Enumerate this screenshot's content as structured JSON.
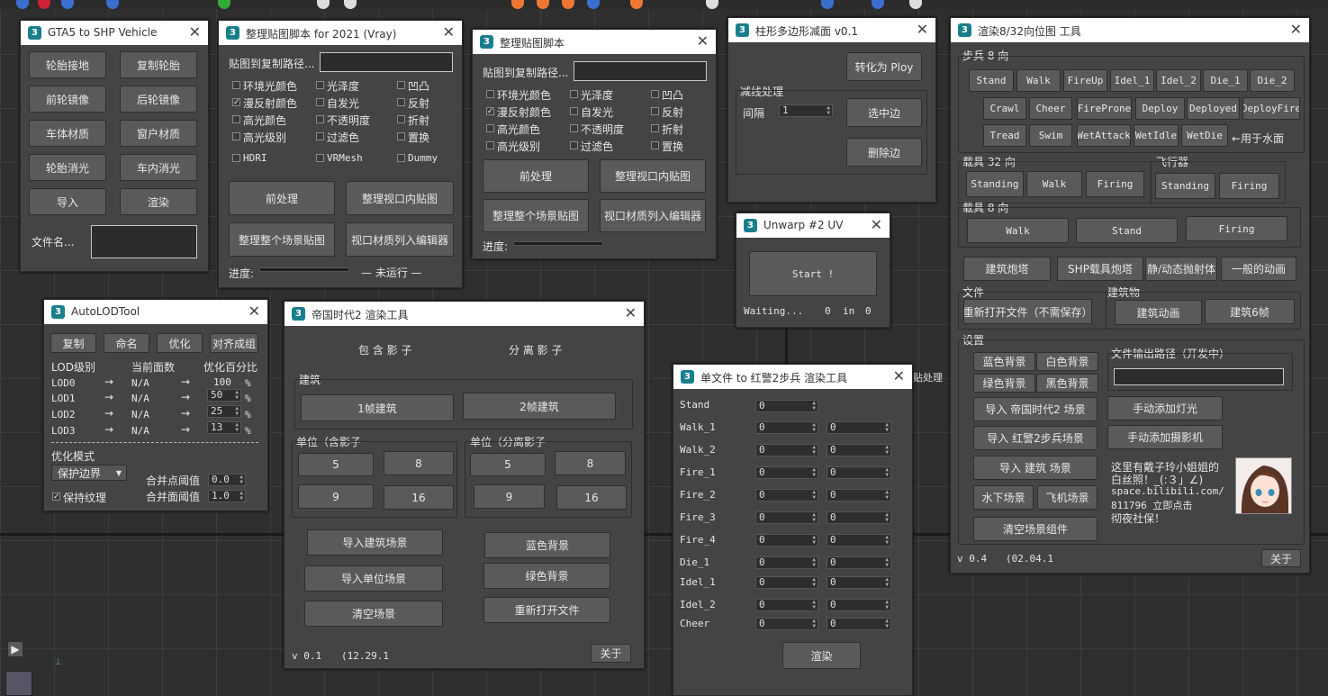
{
  "colors": {
    "accent": "#1a7f8c",
    "viewport": "#2f2f2f",
    "panel": "#444444",
    "button": "#5a5a5a"
  },
  "gta": {
    "title": "GTA5 to SHP Vehicle",
    "btns": [
      "轮胎接地",
      "复制轮胎",
      "前轮镜像",
      "后轮镜像",
      "车体材质",
      "窗户材质",
      "轮胎消光",
      "车内消光",
      "导入",
      "渲染"
    ],
    "file_label": "文件名..."
  },
  "tex21": {
    "title": "整理贴图脚本 for 2021 (Vray)",
    "path_label": "贴图到复制路径...",
    "cbs": [
      "环境光颜色",
      "光泽度",
      "凹凸",
      "漫反射颜色",
      "自发光",
      "反射",
      "高光颜色",
      "不透明度",
      "折射",
      "高光级别",
      "过滤色",
      "置换",
      "HDRI",
      "VRMesh",
      "Dummy"
    ],
    "btns": [
      "前处理",
      "整理视口内贴图",
      "整理整个场景贴图",
      "视口材质列入编辑器"
    ],
    "progress_label": "进度:",
    "status": "— 未运行 —"
  },
  "tex": {
    "title": "整理贴图脚本",
    "path_label": "贴图到复制路径...",
    "cbs": [
      "环境光颜色",
      "光泽度",
      "凹凸",
      "漫反射颜色",
      "自发光",
      "反射",
      "高光颜色",
      "不透明度",
      "折射",
      "高光级别",
      "过滤色",
      "置换"
    ],
    "btns": [
      "前处理",
      "整理视口内贴图",
      "整理整个场景贴图",
      "视口材质列入编辑器"
    ],
    "progress_label": "进度:"
  },
  "poly": {
    "title": "柱形多边形减面 v0.1",
    "convert": "转化为 Ploy",
    "group": "减线处理",
    "interval": "间隔",
    "interval_val": "1",
    "select_edge": "选中边",
    "delete_edge": "删除边"
  },
  "unwrap": {
    "title": "Unwarp #2 UV",
    "start": "Start !",
    "waiting": "Waiting...",
    "count": "0",
    "in": "in",
    "total": "0"
  },
  "lod": {
    "title": "AutoLODTool",
    "btns": [
      "复制",
      "命名",
      "优化",
      "对齐成组"
    ],
    "h1": "LOD级别",
    "h2": "当前面数",
    "h3": "优化百分比",
    "rows": [
      {
        "n": "LOD0",
        "c": "N/A",
        "v": "100"
      },
      {
        "n": "LOD1",
        "c": "N/A",
        "v": "50"
      },
      {
        "n": "LOD2",
        "c": "N/A",
        "v": "25"
      },
      {
        "n": "LOD3",
        "c": "N/A",
        "v": "13"
      }
    ],
    "arrow": "→",
    "pct": "%",
    "mode_label": "优化模式",
    "mode": "保护边界",
    "merge_pt": "合并点阈值",
    "merge_pt_v": "0.0",
    "merge_face": "合并面阈值",
    "merge_face_v": "1.0",
    "keep": "保持纹理"
  },
  "aoe": {
    "title": "帝国时代2 渲染工具",
    "h_shadow": "包 含 影 子",
    "h_sep": "分 离 影 子",
    "bld": "建筑",
    "b1": "1帧建筑",
    "b2": "2帧建筑",
    "unit1": "单位（含影子",
    "unit2": "单位（分离影子",
    "n": [
      "5",
      "8",
      "9",
      "16"
    ],
    "imp_b": "导入建筑场景",
    "imp_u": "导入单位场景",
    "clear": "清空场景",
    "blue": "蓝色背景",
    "green": "绿色背景",
    "reopen": "重新打开文件",
    "ver": "v 0.1",
    "date": "(12.29.1",
    "about": "关于"
  },
  "ra2": {
    "title": "单文件 to 红警2步兵 渲染工具",
    "rows": [
      "Stand",
      "Walk_1",
      "Walk_2",
      "Fire_1",
      "Fire_2",
      "Fire_3",
      "Fire_4",
      "Die_1",
      "Idel_1",
      "Idel_2",
      "Cheer"
    ],
    "v": "0",
    "render": "渲染",
    "bg_text": "贴处理 ]"
  },
  "r8": {
    "title": "渲染8/32向位图 工具",
    "inf": "步兵 8 向",
    "inf1": [
      "Stand",
      "Walk",
      "FireUp",
      "Idel_1",
      "Idel_2",
      "Die_1",
      "Die_2"
    ],
    "inf2": [
      "Crawl",
      "Cheer",
      "FireProne",
      "Deploy",
      "Deployed",
      "DeployFire"
    ],
    "inf3": [
      "Tread",
      "Swim",
      "WetAttack",
      "WetIdle",
      "WetDie"
    ],
    "water": "←用于水面",
    "veh32": "载具 32 向",
    "veh32b": [
      "Standing",
      "Walk",
      "Firing"
    ],
    "air": "飞行器",
    "airb": [
      "Standing",
      "Firing"
    ],
    "veh8": "载具 8 向",
    "veh8b": [
      "Walk",
      "Stand",
      "Firing"
    ],
    "misc": [
      "建筑炮塔",
      "SHP载具炮塔",
      "静/动态抛射体",
      "一般的动画"
    ],
    "file": "文件",
    "reopen": "重新打开文件（不需保存）",
    "bldg": "建筑物",
    "bldg_anim": "建筑动画",
    "bldg6": "建筑6帧",
    "settings": "设置",
    "bg": [
      "蓝色背景",
      "白色背景",
      "绿色背景",
      "黑色背景"
    ],
    "imp_aoe": "导入 帝国时代2 场景",
    "imp_ra2": "导入 红警2步兵场景",
    "imp_bld": "导入 建筑 场景",
    "water_s": "水下场景",
    "plane_s": "飞机场景",
    "clear_s": "清空场景组件",
    "out_path": "文件输出路径（开发中）",
    "add_light": "手动添加灯光",
    "add_cam": "手动添加摄影机",
    "promo1": "这里有戴子玲小姐姐的",
    "promo2": "白丝照！_(:３」∠)",
    "promo3": "space.bilibili.com/",
    "promo4": "811796      立即点击",
    "promo5": "彻夜社保！",
    "ver": "v 0.4",
    "date": "(02.04.1",
    "about": "关于"
  }
}
